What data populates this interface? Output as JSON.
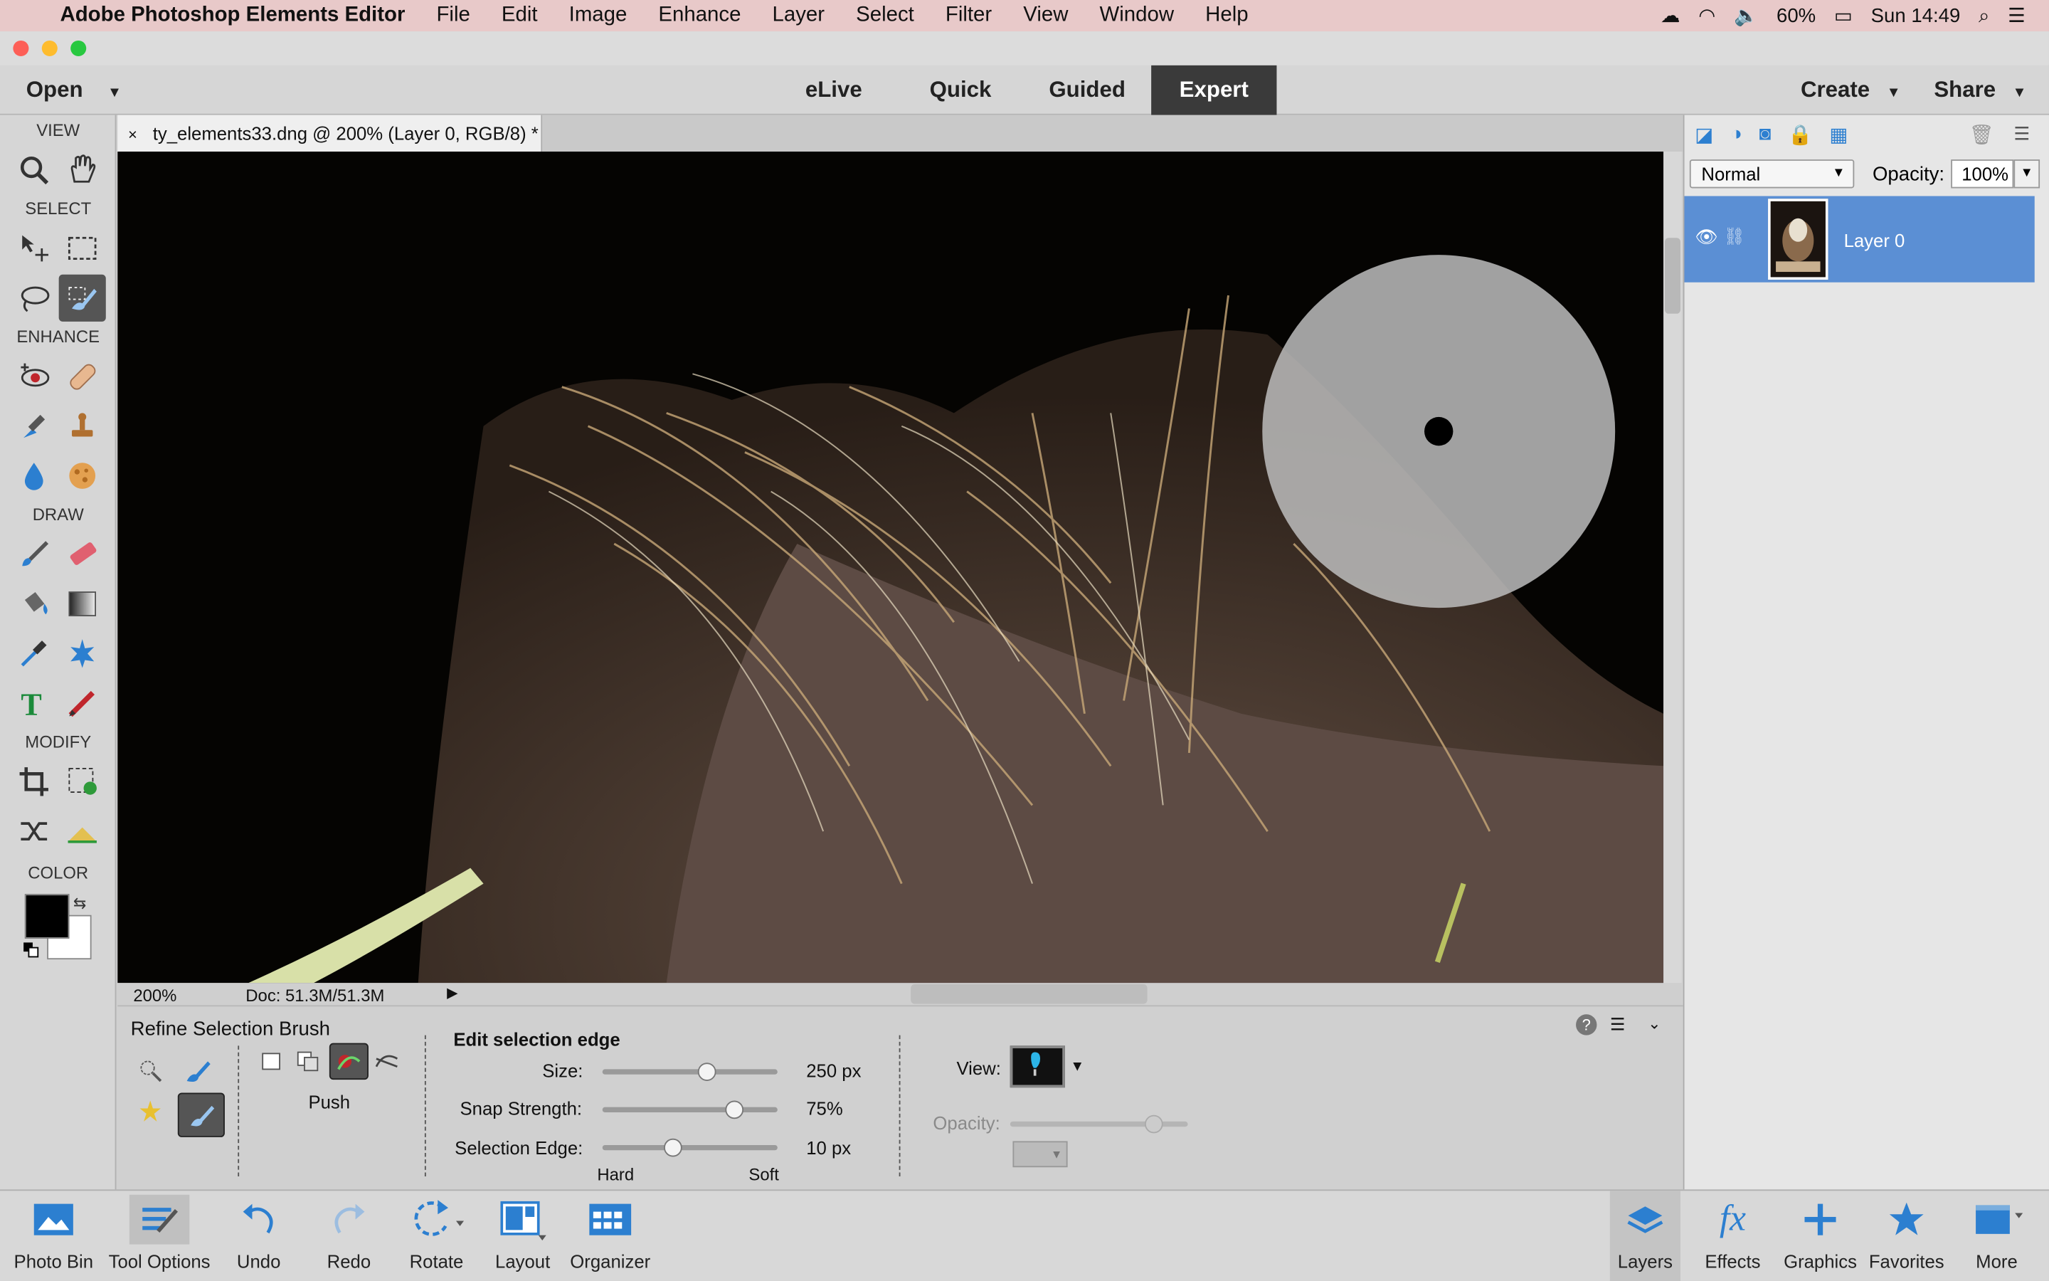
{
  "menubar": {
    "app_name": "Adobe Photoshop Elements Editor",
    "items": [
      "File",
      "Edit",
      "Image",
      "Enhance",
      "Layer",
      "Select",
      "Filter",
      "View",
      "Window",
      "Help"
    ],
    "battery": "60%",
    "clock": "Sun 14:49"
  },
  "modebar": {
    "open_label": "Open",
    "modes": [
      "eLive",
      "Quick",
      "Guided",
      "Expert"
    ],
    "active_mode": "Expert",
    "create_label": "Create",
    "share_label": "Share"
  },
  "toolbox": {
    "sections": [
      "VIEW",
      "SELECT",
      "ENHANCE",
      "DRAW",
      "MODIFY",
      "COLOR"
    ],
    "colors": {
      "foreground": "#000000",
      "background": "#ffffff"
    }
  },
  "document": {
    "tab_title": "ty_elements33.dng @ 200% (Layer 0, RGB/8) *",
    "zoom": "200%",
    "doc_size": "Doc: 51.3M/51.3M"
  },
  "tool_options": {
    "tool_name": "Refine Selection Brush",
    "mode_label": "Push",
    "section_title": "Edit selection edge",
    "size_label": "Size:",
    "size_value": "250 px",
    "size_fraction": 0.6,
    "snap_label": "Snap Strength:",
    "snap_value": "75%",
    "snap_fraction": 0.75,
    "edge_label": "Selection Edge:",
    "edge_value": "10 px",
    "edge_fraction": 0.4,
    "hard_label": "Hard",
    "soft_label": "Soft",
    "view_label": "View:",
    "opacity_label": "Opacity:"
  },
  "layers_panel": {
    "blend_mode": "Normal",
    "opacity_label": "Opacity:",
    "opacity_value": "100%",
    "layers": [
      {
        "name": "Layer 0",
        "visible": true,
        "selected": true
      }
    ]
  },
  "taskbar": {
    "photo_bin": "Photo Bin",
    "tool_options": "Tool Options",
    "undo": "Undo",
    "redo": "Redo",
    "rotate": "Rotate",
    "layout": "Layout",
    "organizer": "Organizer",
    "layers": "Layers",
    "effects": "Effects",
    "graphics": "Graphics",
    "favorites": "Favorites",
    "more": "More"
  },
  "accent_colors": {
    "selection_blue": "#5b8fd4",
    "icon_blue": "#2c7fd0",
    "mode_active_bg": "#3a3a3a"
  }
}
